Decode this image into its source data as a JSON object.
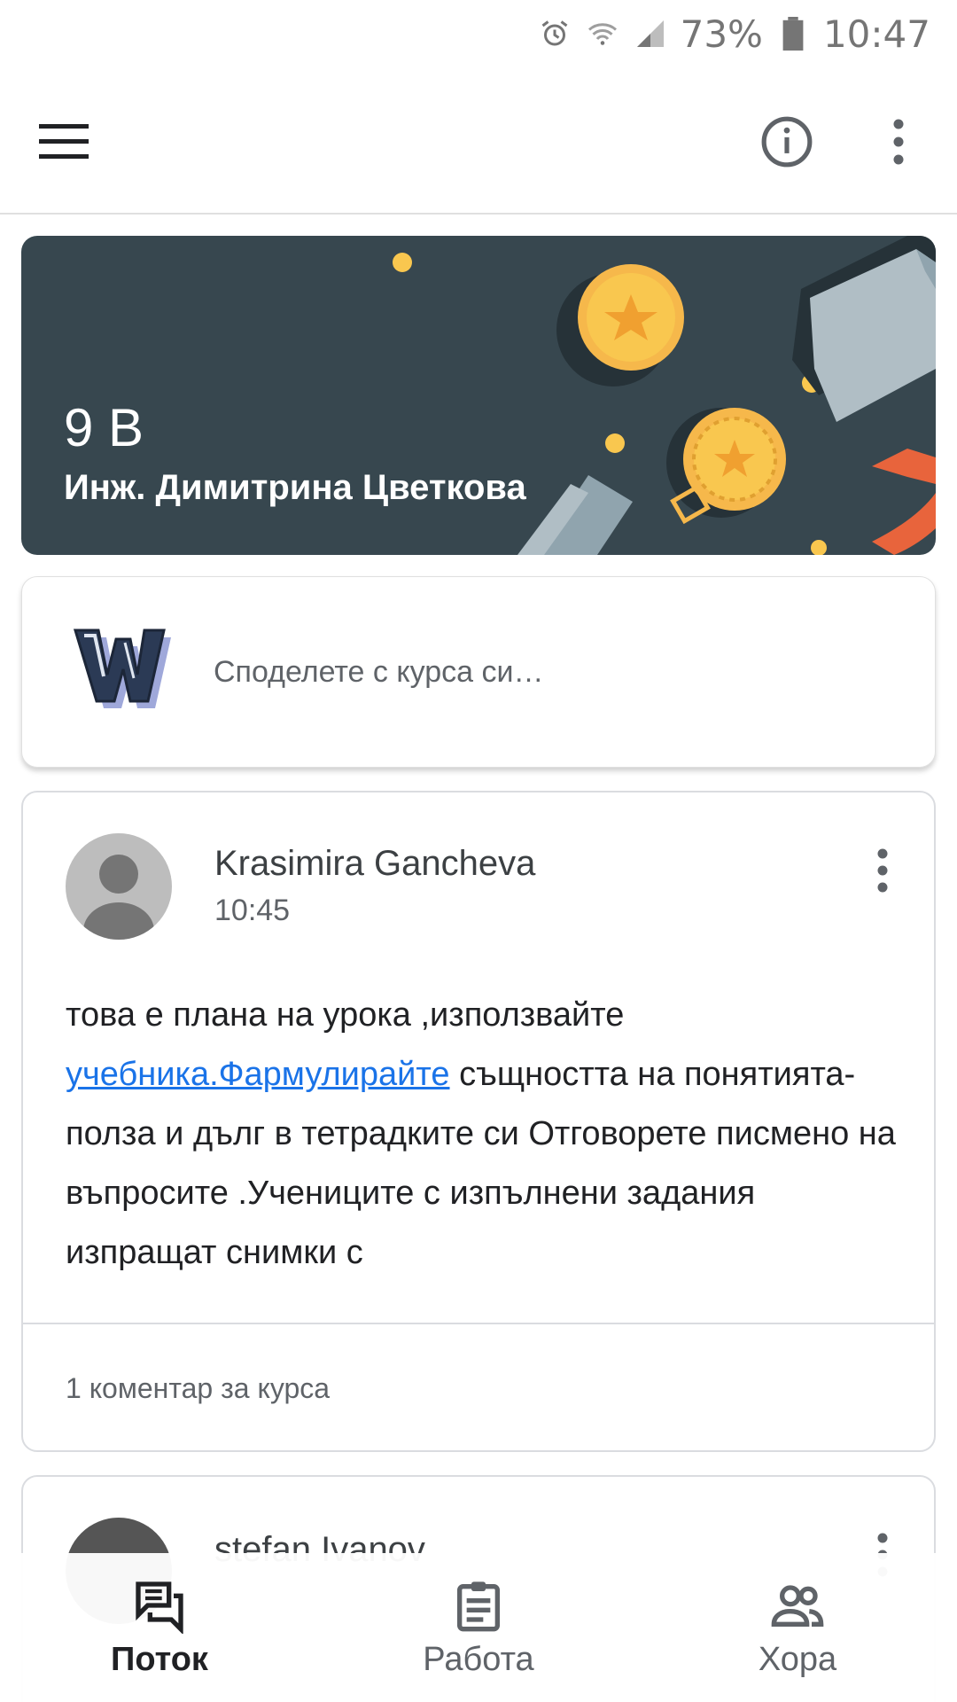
{
  "status_bar": {
    "battery": "73%",
    "time": "10:47",
    "icons": [
      "alarm-icon",
      "wifi-icon",
      "signal-icon",
      "battery-icon"
    ]
  },
  "app_bar": {
    "icons": [
      "menu-icon",
      "info-icon",
      "more-vert-icon"
    ]
  },
  "banner": {
    "class_name": "9 В",
    "teacher": "Инж. Димитрина Цветкова",
    "background_color": "#37474f"
  },
  "share": {
    "placeholder": "Споделете с курса си…"
  },
  "posts": [
    {
      "author": "Krasimira Gancheva",
      "time": "10:45",
      "body_before_link": "това е плана на урока ,използвайте ",
      "link_text": "учебника.Фармулирайте",
      "body_after_link": " същността на понятията- полза и дълг в тетрадките си Отговорете писмено на въпросите .Учениците с изпълнени задания изпращат снимки с",
      "comments": "1 коментар за курса"
    },
    {
      "author": "stefan Ivanov"
    }
  ],
  "bottom_nav": {
    "items": [
      {
        "label": "Поток",
        "icon": "stream-icon",
        "active": true
      },
      {
        "label": "Работа",
        "icon": "classwork-icon",
        "active": false
      },
      {
        "label": "Хора",
        "icon": "people-icon",
        "active": false
      }
    ]
  },
  "colors": {
    "link": "#1a73e8",
    "text_secondary": "#5f6368",
    "accent_gold": "#f9c74f",
    "ribbon": "#e8643c"
  }
}
